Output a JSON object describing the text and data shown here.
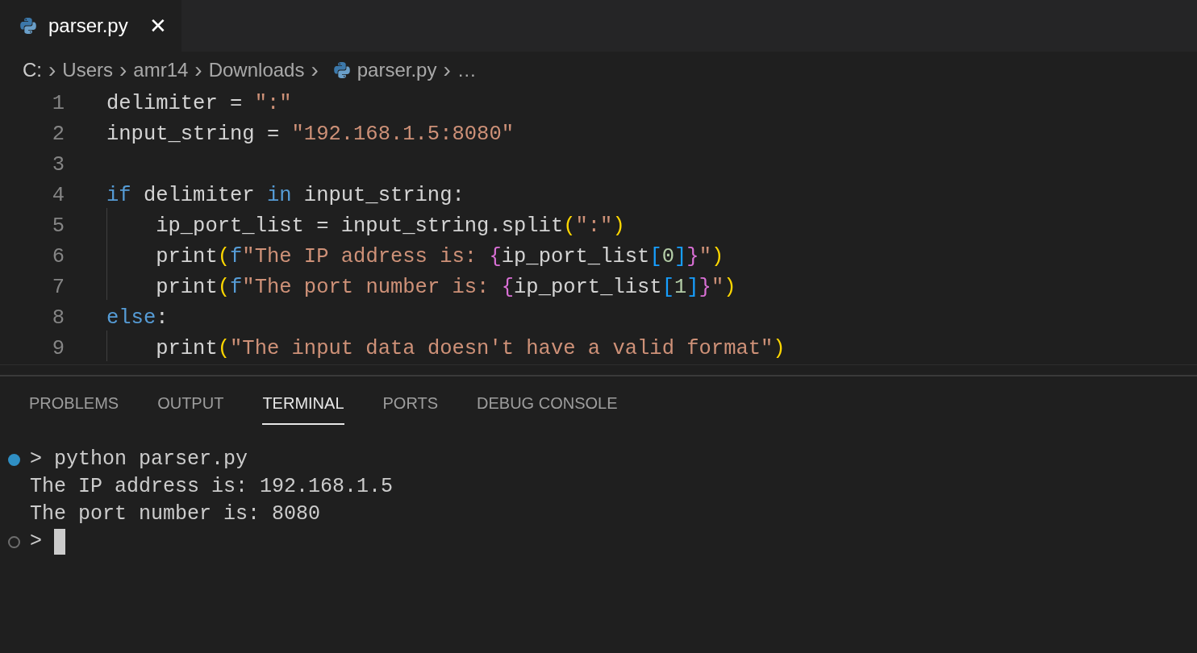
{
  "tabs": [
    {
      "label": "parser.py",
      "selected": true,
      "close": "✕"
    }
  ],
  "breadcrumbs": [
    {
      "label": "C:",
      "kind": "text"
    },
    {
      "label": "Users",
      "kind": "text"
    },
    {
      "label": "amr14",
      "kind": "text"
    },
    {
      "label": "Downloads",
      "kind": "text"
    },
    {
      "label": "parser.py",
      "kind": "file"
    },
    {
      "label": "…",
      "kind": "text"
    }
  ],
  "breadcrumb_separator": "›",
  "editor": {
    "lines": [
      {
        "number": "1",
        "tokens": [
          {
            "kind": "plain",
            "text": "delimiter = "
          },
          {
            "kind": "string",
            "text": "\":\""
          }
        ]
      },
      {
        "number": "2",
        "tokens": [
          {
            "kind": "plain",
            "text": "input_string = "
          },
          {
            "kind": "string",
            "text": "\"192.168.1.5:8080\""
          }
        ]
      },
      {
        "number": "3"
      },
      {
        "number": "4",
        "tokens": [
          {
            "kind": "keyword",
            "text": "if"
          },
          {
            "kind": "plain",
            "text": " delimiter "
          },
          {
            "kind": "keyword",
            "text": "in"
          },
          {
            "kind": "plain",
            "text": " input_string:"
          }
        ]
      },
      {
        "number": "5",
        "tokens": [
          {
            "kind": "plain",
            "text": "    ip_port_list = input_string.split"
          },
          {
            "kind": "paren",
            "text": "("
          },
          {
            "kind": "string",
            "text": "\":\""
          },
          {
            "kind": "paren",
            "text": ")"
          }
        ]
      },
      {
        "number": "6",
        "tokens": [
          {
            "kind": "plain",
            "text": "    print"
          },
          {
            "kind": "paren",
            "text": "("
          },
          {
            "kind": "keyword",
            "text": "f"
          },
          {
            "kind": "string",
            "text": "\"The IP address is: "
          },
          {
            "kind": "brace",
            "text": "{"
          },
          {
            "kind": "plain",
            "text": "ip_port_list"
          },
          {
            "kind": "bracket",
            "text": "["
          },
          {
            "kind": "number",
            "text": "0"
          },
          {
            "kind": "bracket",
            "text": "]"
          },
          {
            "kind": "brace",
            "text": "}"
          },
          {
            "kind": "string",
            "text": "\""
          },
          {
            "kind": "paren",
            "text": ")"
          }
        ]
      },
      {
        "number": "7",
        "tokens": [
          {
            "kind": "plain",
            "text": "    print"
          },
          {
            "kind": "paren",
            "text": "("
          },
          {
            "kind": "keyword",
            "text": "f"
          },
          {
            "kind": "string",
            "text": "\"The port number is: "
          },
          {
            "kind": "brace",
            "text": "{"
          },
          {
            "kind": "plain",
            "text": "ip_port_list"
          },
          {
            "kind": "bracket",
            "text": "["
          },
          {
            "kind": "number",
            "text": "1"
          },
          {
            "kind": "bracket",
            "text": "]"
          },
          {
            "kind": "brace",
            "text": "}"
          },
          {
            "kind": "string",
            "text": "\""
          },
          {
            "kind": "paren",
            "text": ")"
          }
        ]
      },
      {
        "number": "8",
        "tokens": [
          {
            "kind": "keyword",
            "text": "else"
          },
          {
            "kind": "plain",
            "text": ":"
          }
        ]
      },
      {
        "number": "9",
        "tokens": [
          {
            "kind": "plain",
            "text": "    print"
          },
          {
            "kind": "paren",
            "text": "("
          },
          {
            "kind": "string",
            "text": "\"The input data doesn't have a valid format\""
          },
          {
            "kind": "paren",
            "text": ")"
          }
        ]
      }
    ]
  },
  "panel": {
    "tabs": [
      {
        "label": "PROBLEMS",
        "selected": false
      },
      {
        "label": "OUTPUT",
        "selected": false
      },
      {
        "label": "TERMINAL",
        "selected": true
      },
      {
        "label": "PORTS",
        "selected": false
      },
      {
        "label": "DEBUG CONSOLE",
        "selected": false
      }
    ],
    "terminal": [
      {
        "kind": "command",
        "completed": true,
        "prompt": ">",
        "text": "python parser.py"
      },
      {
        "kind": "output",
        "text": "The IP address is: 192.168.1.5"
      },
      {
        "kind": "output",
        "text": "The port number is: 8080"
      },
      {
        "kind": "command",
        "completed": false,
        "prompt": ">",
        "cursor": true
      }
    ]
  }
}
